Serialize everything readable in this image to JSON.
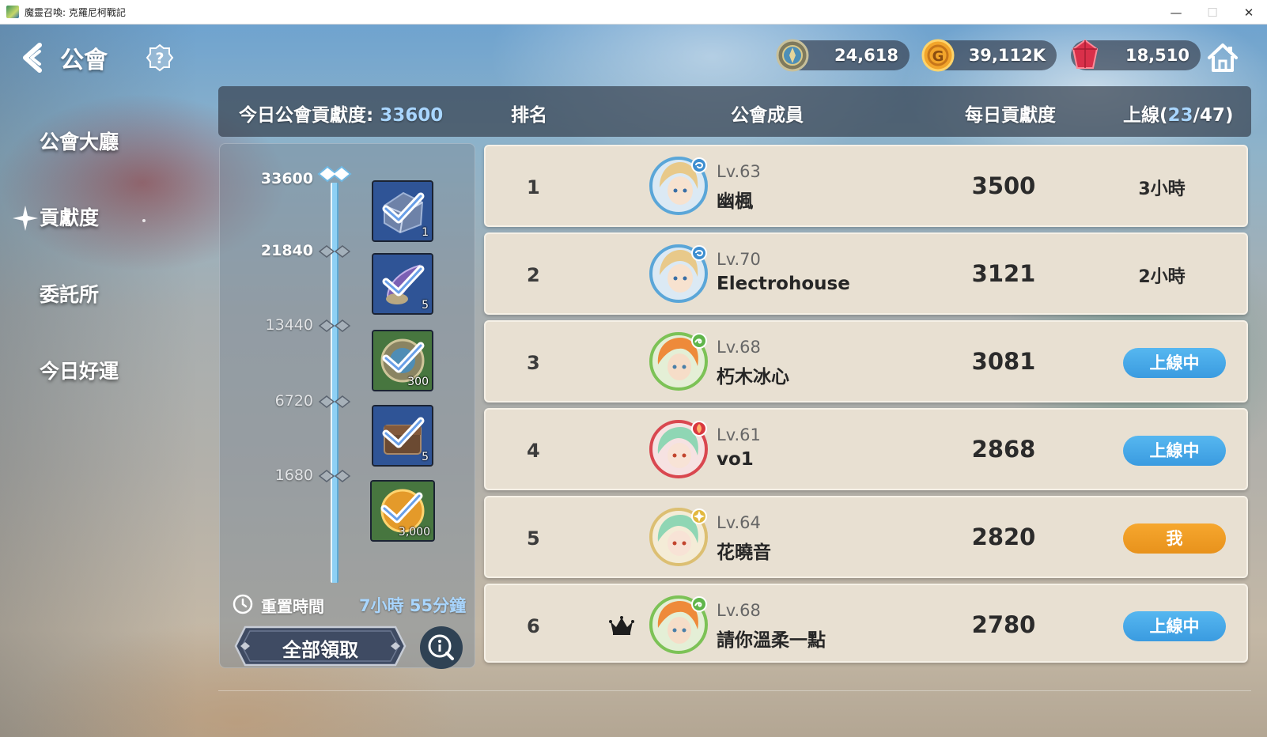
{
  "window": {
    "title": "魔靈召喚: 克羅尼柯戰記",
    "minimize_glyph": "—",
    "maximize_glyph": "☐",
    "close_glyph": "✕"
  },
  "header": {
    "title": "公會",
    "back_icon": "back-chevron-icon",
    "help_icon": "help-question-icon"
  },
  "currencies": [
    {
      "icon": "guild-coin-icon",
      "value": "24,618",
      "color": "#8a7a4a"
    },
    {
      "icon": "gold-coin-icon",
      "value": "39,112K",
      "color": "#f0a32a"
    },
    {
      "icon": "red-crystal-icon",
      "value": "18,510",
      "color": "#e0384c"
    }
  ],
  "side_menu": [
    {
      "label": "公會大廳",
      "active": false
    },
    {
      "label": "貢獻度",
      "active": true
    },
    {
      "label": "委託所",
      "active": false
    },
    {
      "label": "今日好運",
      "active": false
    }
  ],
  "list_header": {
    "today_label": "今日公會貢獻度:",
    "today_value": "33600",
    "rank": "排名",
    "member": "公會成員",
    "daily": "每日貢獻度",
    "online_prefix": "上線(",
    "online_count": "23",
    "online_suffix": "/47)"
  },
  "milestones": [
    {
      "value": "33600",
      "reached": true,
      "reward_icon": "blue-chest-icon",
      "qty": "1"
    },
    {
      "value": "21840",
      "reached": true,
      "reward_icon": "summon-scroll-icon",
      "qty": "5"
    },
    {
      "value": "13440",
      "reached": true,
      "reward_icon": "guild-coin-icon",
      "qty": "300"
    },
    {
      "value": "6720",
      "reached": true,
      "reward_icon": "wooden-chest-icon",
      "qty": "5"
    },
    {
      "value": "1680",
      "reached": true,
      "reward_icon": "gold-coin-icon",
      "qty": "3,000"
    }
  ],
  "reset": {
    "label": "重置時間",
    "time": "7小時 55分鐘"
  },
  "claim_all_label": "全部領取",
  "info_icon": "info-icon",
  "members": [
    {
      "rank": "1",
      "level": "Lv.63",
      "name": "幽楓",
      "contribution": "3500",
      "status": "3小時",
      "status_type": "text",
      "element": "water",
      "crown": false,
      "avatar": "blonde-hero-avatar"
    },
    {
      "rank": "2",
      "level": "Lv.70",
      "name": "Electrohouse",
      "contribution": "3121",
      "status": "2小時",
      "status_type": "text",
      "element": "water",
      "crown": false,
      "avatar": "blonde-hero-avatar"
    },
    {
      "rank": "3",
      "level": "Lv.68",
      "name": "朽木冰心",
      "contribution": "3081",
      "status": "上線中",
      "status_type": "online",
      "element": "wind",
      "crown": false,
      "avatar": "orange-hair-avatar"
    },
    {
      "rank": "4",
      "level": "Lv.61",
      "name": "vo1",
      "contribution": "2868",
      "status": "上線中",
      "status_type": "online",
      "element": "fire",
      "crown": false,
      "avatar": "green-hair-avatar"
    },
    {
      "rank": "5",
      "level": "Lv.64",
      "name": "花曉音",
      "contribution": "2820",
      "status": "我",
      "status_type": "me",
      "element": "light",
      "crown": false,
      "avatar": "green-hair-avatar"
    },
    {
      "rank": "6",
      "level": "Lv.68",
      "name": "請你溫柔一點",
      "contribution": "2780",
      "status": "上線中",
      "status_type": "online",
      "element": "wind",
      "crown": true,
      "avatar": "orange-hair-avatar"
    }
  ]
}
